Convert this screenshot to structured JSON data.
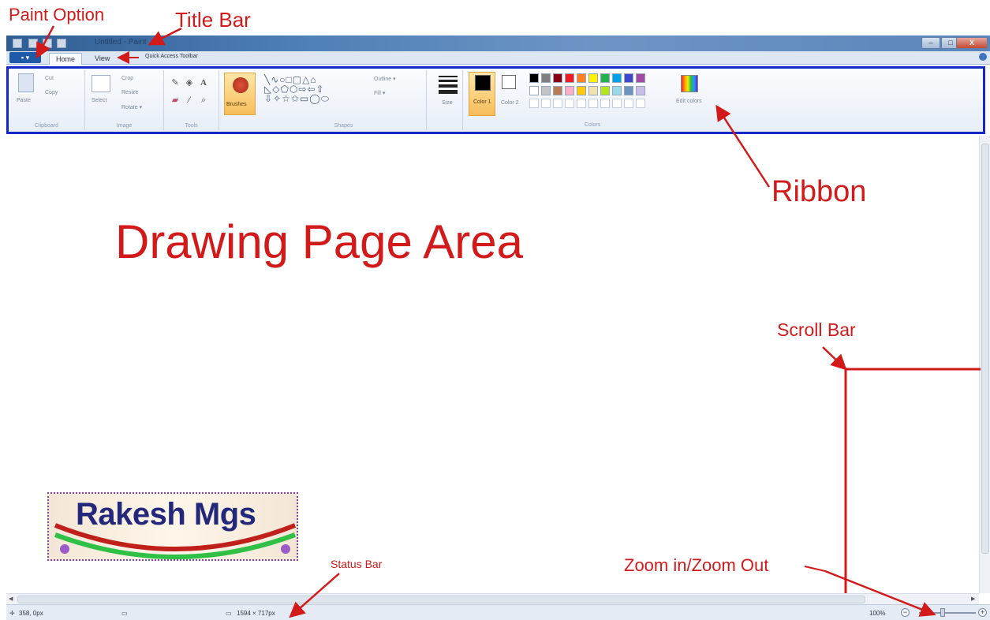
{
  "window": {
    "title": "Untitled - Paint",
    "minimize_label": "–",
    "maximize_label": "□",
    "close_label": "X"
  },
  "tabs": {
    "paint_button": "▪ ▾",
    "items": [
      "Home",
      "View"
    ],
    "quick_access_label": "Quick Access Toolbar"
  },
  "ribbon": {
    "clipboard": {
      "paste": "Paste",
      "cut": "Cut",
      "copy": "Copy",
      "label": "Clipboard"
    },
    "image": {
      "select": "Select",
      "crop": "Crop",
      "resize": "Resize",
      "rotate": "Rotate ▾",
      "label": "Image"
    },
    "tools": {
      "label": "Tools"
    },
    "brushes": {
      "label": "Brushes"
    },
    "shapes": {
      "outline": "Outline ▾",
      "fill": "Fill ▾",
      "label": "Shapes"
    },
    "size": {
      "label": "Size"
    },
    "colors": {
      "color1": "Color 1",
      "color2": "Color 2",
      "edit": "Edit colors",
      "label": "Colors"
    }
  },
  "palette_row1": [
    "#000000",
    "#7f7f7f",
    "#880015",
    "#ed1c24",
    "#ff7f27",
    "#fff200",
    "#22b14c",
    "#00a2e8",
    "#3f48cc",
    "#a349a4"
  ],
  "palette_row2": [
    "#ffffff",
    "#c3c3c3",
    "#b97a57",
    "#ffaec9",
    "#ffc90e",
    "#efe4b0",
    "#b5e61d",
    "#99d9ea",
    "#7092be",
    "#c8bfe7"
  ],
  "statusbar": {
    "position": "358, 0px",
    "dimensions": "1594 × 717px",
    "zoom": "100%",
    "zoom_out": "−",
    "zoom_in": "+"
  },
  "logo": {
    "text": "Rakesh Mgs"
  },
  "annotations": {
    "paint_option": "Paint Option",
    "title_bar": "Title Bar",
    "ribbon": "Ribbon",
    "drawing_area": "Drawing Page Area",
    "scroll_bar": "Scroll Bar",
    "status_bar": "Status Bar",
    "zoom": "Zoom in/Zoom Out"
  },
  "colors": {
    "annotation": "#d21a1a",
    "ribbon_highlight": "#1428c8"
  }
}
